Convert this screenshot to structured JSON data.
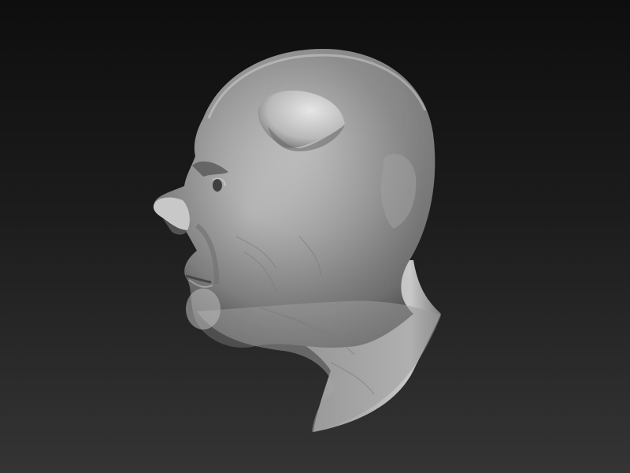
{
  "viewport": {
    "background_top": "#0e0e0e",
    "background_bottom": "#343434"
  },
  "model": {
    "material_base": "#a9a9a9",
    "material_light": "#dcdcdc",
    "material_shadow": "#4e4e4e",
    "shading": "matcap-gray",
    "features": [
      "bald-head",
      "horn",
      "nose",
      "eye",
      "mouth",
      "chin",
      "ear",
      "neck",
      "skin-wrinkles"
    ]
  }
}
